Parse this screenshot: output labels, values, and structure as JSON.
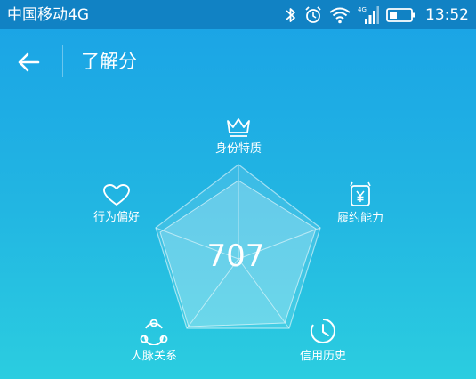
{
  "status_bar": {
    "carrier": "中国移动4G",
    "network_badge": "4G",
    "time": "13:52",
    "icons": [
      "bluetooth-icon",
      "alarm-icon",
      "wifi-icon",
      "signal-icon",
      "battery-icon"
    ]
  },
  "header": {
    "title": "了解分",
    "back_icon": "arrow-left-icon"
  },
  "score": {
    "value": "707"
  },
  "dimensions": [
    {
      "label": "身份特质",
      "icon": "crown-icon"
    },
    {
      "label": "履约能力",
      "icon": "wallet-yen-icon"
    },
    {
      "label": "信用历史",
      "icon": "clock-icon"
    },
    {
      "label": "人脉关系",
      "icon": "network-icon"
    },
    {
      "label": "行为偏好",
      "icon": "heart-icon"
    }
  ],
  "colors": {
    "status_bar": "#1182c4",
    "background_top": "#1aa2e6",
    "background_bottom": "#2bcde0",
    "text": "#ffffff"
  }
}
